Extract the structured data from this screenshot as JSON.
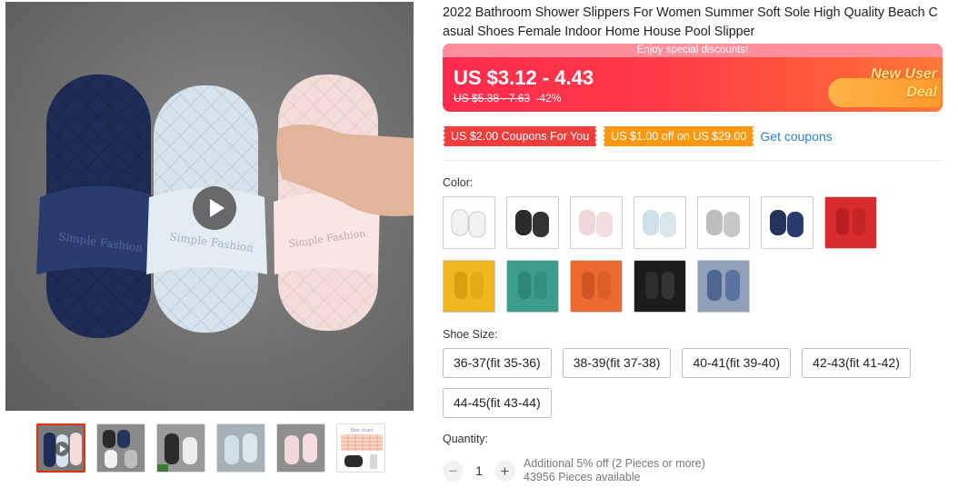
{
  "product": {
    "title": "2022 Bathroom Shower Slippers For Women Summer Soft Sole High Quality Beach Casual Shoes Female Indoor Home House Pool Slipper"
  },
  "gallery": {
    "main_image_alt": "Three slippers (navy, light blue, pink) on gray floor",
    "video_icon": "play-icon",
    "thumbnails": [
      "thumb-1",
      "thumb-2",
      "thumb-3",
      "thumb-4",
      "thumb-5",
      "size-chart"
    ],
    "size_chart_caption": "Size chart"
  },
  "price": {
    "promo_strip": "Enjoy special discounts!",
    "current": "US $3.12 - 4.43",
    "original": "US $5.38 - 7.63",
    "discount": "-42%",
    "badge_line1": "New User",
    "badge_line2": "Deal"
  },
  "coupons": [
    {
      "label": "US $2.00 Coupons For You",
      "color": "#f33d3d"
    },
    {
      "label": "US $1.00 off on US $29.00",
      "color": "#ff9810"
    }
  ],
  "get_coupons_label": "Get coupons",
  "color": {
    "label": "Color:",
    "options": [
      {
        "name": "white",
        "color": "#f2f2f2"
      },
      {
        "name": "black",
        "color": "#2b2b2b"
      },
      {
        "name": "pink",
        "color": "#f1d6da"
      },
      {
        "name": "light-blue",
        "color": "#cfe0ea"
      },
      {
        "name": "gray",
        "color": "#bdbdbd"
      },
      {
        "name": "navy",
        "color": "#23335a"
      },
      {
        "name": "red",
        "color": "#d92c2f"
      },
      {
        "name": "yellow",
        "color": "#f0b820"
      },
      {
        "name": "green",
        "color": "#3b9d8c"
      },
      {
        "name": "orange",
        "color": "#ea6a30"
      },
      {
        "name": "black-2",
        "color": "#1c1c1c"
      },
      {
        "name": "blue-gray",
        "color": "#4f6690"
      }
    ]
  },
  "shoe_size": {
    "label": "Shoe Size:",
    "options": [
      "36-37(fit 35-36)",
      "38-39(fit 37-38)",
      "40-41(fit 39-40)",
      "42-43(fit 41-42)",
      "44-45(fit 43-44)"
    ]
  },
  "quantity": {
    "label": "Quantity:",
    "value": "1",
    "minus": "−",
    "plus": "+",
    "offer": "Additional 5% off (2 Pieces or more)",
    "available": "43956 Pieces available"
  }
}
